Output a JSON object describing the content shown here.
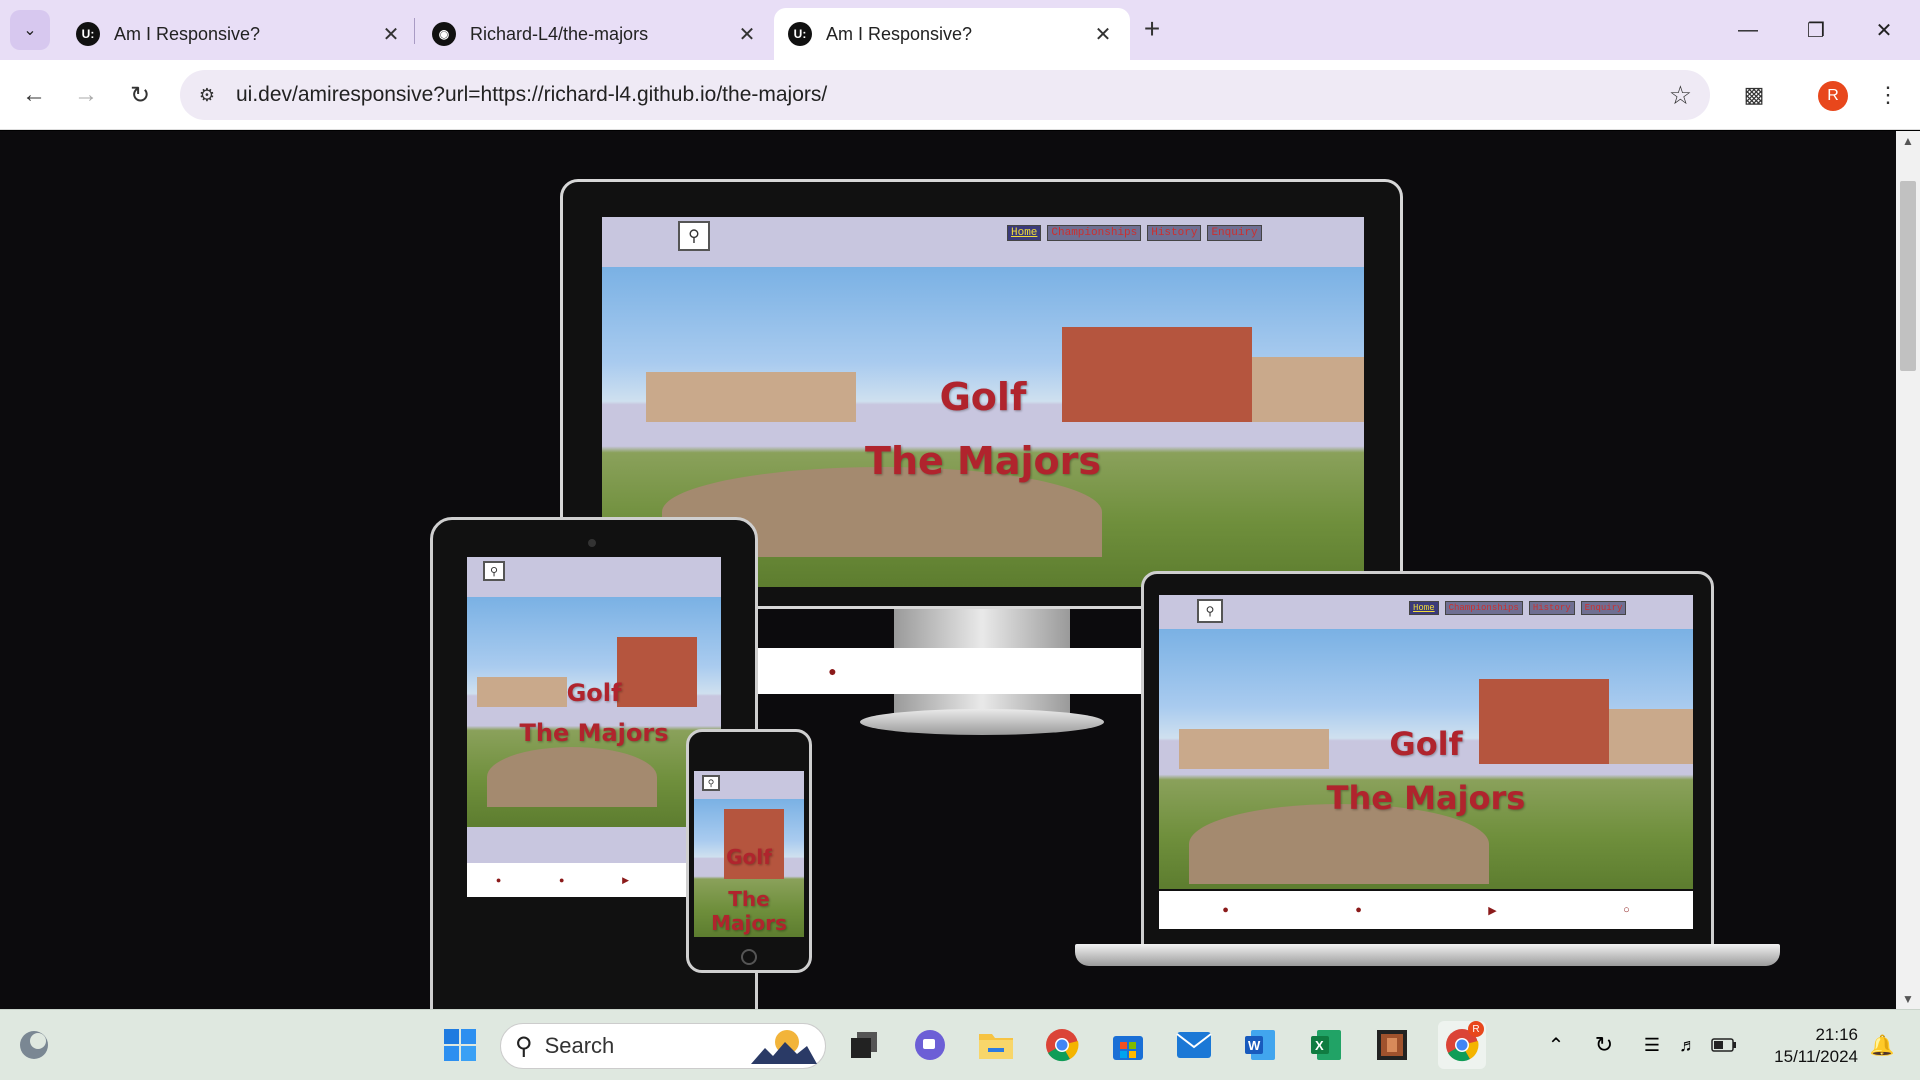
{
  "browser": {
    "tabs": [
      {
        "title": "Am I Responsive?",
        "favicon": "U:",
        "active": false
      },
      {
        "title": "Richard-L4/the-majors",
        "favicon": "github",
        "active": false
      },
      {
        "title": "Am I Responsive?",
        "favicon": "U:",
        "active": true
      }
    ],
    "address": {
      "domain": "ui.dev",
      "path": "/amiresponsive?url=https://richard-l4.github.io/the-majors/"
    },
    "profile_initial": "R"
  },
  "site": {
    "nav": [
      "Home",
      "Championships",
      "History",
      "Enquiry"
    ],
    "hero_line1": "Golf",
    "hero_line2": "The Majors",
    "footer_icons": [
      "facebook-icon",
      "twitter-icon",
      "youtube-icon",
      "instagram-icon"
    ]
  },
  "taskbar": {
    "search_placeholder": "Search",
    "time": "21:16",
    "date": "15/11/2024",
    "chrome_badge": "R"
  },
  "colors": {
    "tab_strip": "#e8def6",
    "hero_title": "#b0242d",
    "page_bg": "#0c0b0d",
    "nav_active_text": "#f1dc3a"
  }
}
